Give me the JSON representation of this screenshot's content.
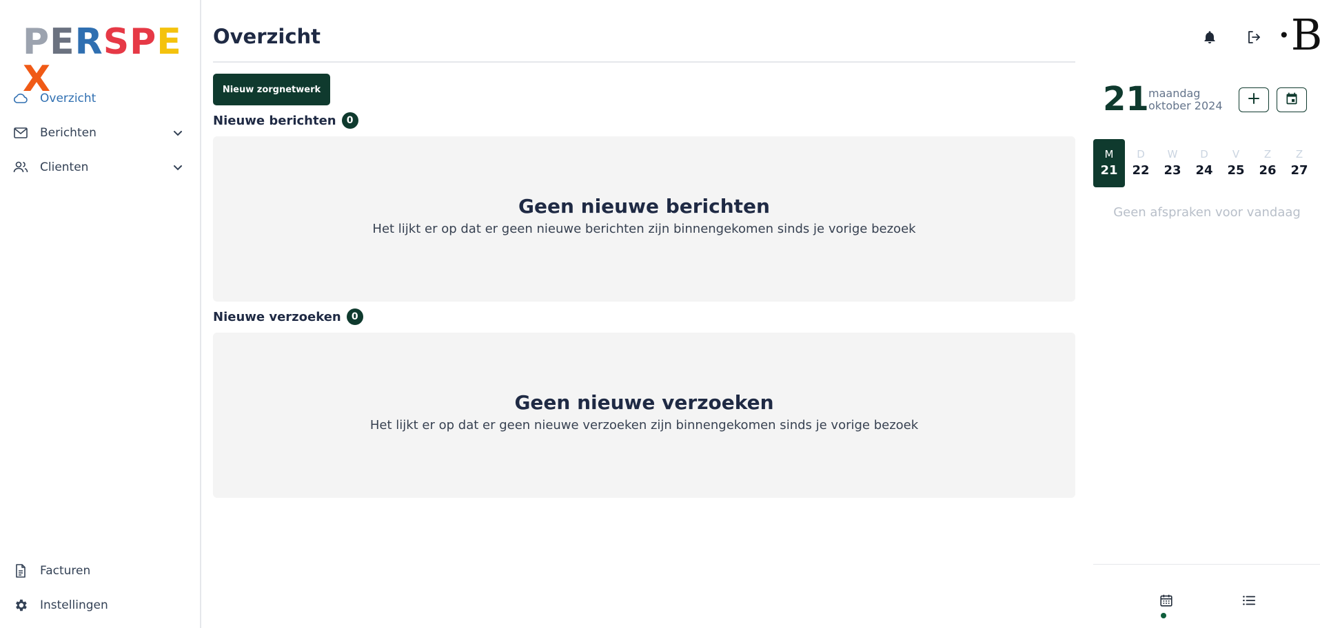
{
  "brand": {
    "logo_letters": [
      "P",
      "E",
      "R",
      "S",
      "P",
      "E",
      "X"
    ],
    "logo_colors": [
      "#9ca3af",
      "#6b7280",
      "#2f6fb1",
      "#e63946",
      "#e63946",
      "#f4c20d",
      "#f05a16"
    ]
  },
  "sidebar": {
    "items": [
      {
        "label": "Overzicht",
        "icon": "cloud-icon",
        "active": true
      },
      {
        "label": "Berichten",
        "icon": "mail-icon",
        "expandable": true
      },
      {
        "label": "Clienten",
        "icon": "users-icon",
        "expandable": true
      }
    ],
    "bottom_items": [
      {
        "label": "Facturen",
        "icon": "document-icon"
      },
      {
        "label": "Instellingen",
        "icon": "gear-icon"
      }
    ]
  },
  "header": {
    "title": "Overzicht",
    "icons": [
      "bell-icon",
      "logout-icon"
    ],
    "avatar_text": "·B"
  },
  "main": {
    "new_network_button": "Nieuw zorgnetwerk",
    "messages": {
      "title": "Nieuwe berichten",
      "count": "0",
      "empty_title": "Geen nieuwe berichten",
      "empty_text": "Het lijkt er op dat er geen nieuwe berichten zijn binnengekomen sinds je vorige bezoek"
    },
    "requests": {
      "title": "Nieuwe verzoeken",
      "count": "0",
      "empty_title": "Geen nieuwe verzoeken",
      "empty_text": "Het lijkt er op dat er geen nieuwe verzoeken zijn binnengekomen sinds je vorige bezoek"
    }
  },
  "calendar": {
    "day": "21",
    "weekday": "maandag",
    "month_year": "oktober 2024",
    "week": [
      {
        "wd": "M",
        "dn": "21",
        "selected": true
      },
      {
        "wd": "D",
        "dn": "22"
      },
      {
        "wd": "W",
        "dn": "23"
      },
      {
        "wd": "D",
        "dn": "24"
      },
      {
        "wd": "V",
        "dn": "25"
      },
      {
        "wd": "Z",
        "dn": "26"
      },
      {
        "wd": "Z",
        "dn": "27"
      }
    ],
    "no_appointments": "Geen afspraken voor vandaag",
    "bottom_tabs": [
      "calendar-icon",
      "list-icon"
    ],
    "accent_color": "#0f3a2e"
  }
}
